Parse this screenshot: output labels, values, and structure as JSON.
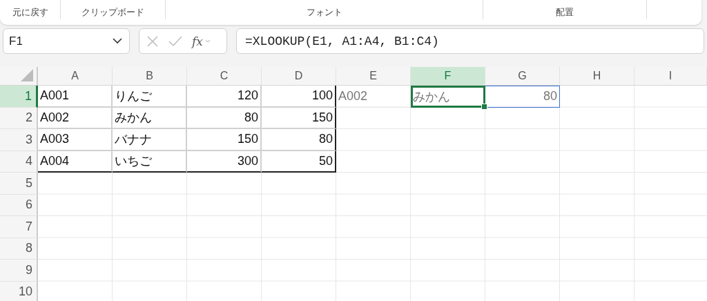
{
  "ribbon": {
    "groups": [
      {
        "label": "元に戻す"
      },
      {
        "label": "クリップボード"
      },
      {
        "label": "フォント"
      },
      {
        "label": "配置"
      }
    ]
  },
  "formula_bar": {
    "name_box": "F1",
    "function_label": "fx",
    "formula": "=XLOOKUP(E1, A1:A4, B1:C4)"
  },
  "sheet": {
    "columns": [
      {
        "label": "A",
        "selected": false
      },
      {
        "label": "B",
        "selected": false
      },
      {
        "label": "C",
        "selected": false
      },
      {
        "label": "D",
        "selected": false
      },
      {
        "label": "E",
        "selected": false
      },
      {
        "label": "F",
        "selected": true
      },
      {
        "label": "G",
        "selected": false
      },
      {
        "label": "H",
        "selected": false
      },
      {
        "label": "I",
        "selected": false
      }
    ],
    "rows": [
      {
        "number": "1",
        "selected": true,
        "cells": [
          {
            "text": "A001",
            "kind": "text",
            "bordered": true,
            "dimmed": false,
            "spill": false,
            "selected": false
          },
          {
            "text": "りんご",
            "kind": "text",
            "bordered": true,
            "dimmed": false,
            "spill": false,
            "selected": false
          },
          {
            "text": "120",
            "kind": "number",
            "bordered": true,
            "dimmed": false,
            "spill": false,
            "selected": false
          },
          {
            "text": "100",
            "kind": "number",
            "bordered": true,
            "dimmed": false,
            "spill": false,
            "selected": false
          },
          {
            "text": "A002",
            "kind": "text",
            "bordered": false,
            "dimmed": true,
            "spill": false,
            "selected": false
          },
          {
            "text": "みかん",
            "kind": "text",
            "bordered": false,
            "dimmed": true,
            "spill": true,
            "selected": true
          },
          {
            "text": "80",
            "kind": "number",
            "bordered": false,
            "dimmed": true,
            "spill": true,
            "selected": false
          }
        ]
      },
      {
        "number": "2",
        "selected": false,
        "cells": [
          {
            "text": "A002",
            "kind": "text",
            "bordered": true,
            "dimmed": false,
            "spill": false,
            "selected": false
          },
          {
            "text": "みかん",
            "kind": "text",
            "bordered": true,
            "dimmed": false,
            "spill": false,
            "selected": false
          },
          {
            "text": "80",
            "kind": "number",
            "bordered": true,
            "dimmed": false,
            "spill": false,
            "selected": false
          },
          {
            "text": "150",
            "kind": "number",
            "bordered": true,
            "dimmed": false,
            "spill": false,
            "selected": false
          }
        ]
      },
      {
        "number": "3",
        "selected": false,
        "cells": [
          {
            "text": "A003",
            "kind": "text",
            "bordered": true,
            "dimmed": false,
            "spill": false,
            "selected": false
          },
          {
            "text": "バナナ",
            "kind": "text",
            "bordered": true,
            "dimmed": false,
            "spill": false,
            "selected": false
          },
          {
            "text": "150",
            "kind": "number",
            "bordered": true,
            "dimmed": false,
            "spill": false,
            "selected": false
          },
          {
            "text": "80",
            "kind": "number",
            "bordered": true,
            "dimmed": false,
            "spill": false,
            "selected": false
          }
        ]
      },
      {
        "number": "4",
        "selected": false,
        "cells": [
          {
            "text": "A004",
            "kind": "text",
            "bordered": true,
            "dimmed": false,
            "spill": false,
            "selected": false
          },
          {
            "text": "いちご",
            "kind": "text",
            "bordered": true,
            "dimmed": false,
            "spill": false,
            "selected": false
          },
          {
            "text": "300",
            "kind": "number",
            "bordered": true,
            "dimmed": false,
            "spill": false,
            "selected": false
          },
          {
            "text": "50",
            "kind": "number",
            "bordered": true,
            "dimmed": false,
            "spill": false,
            "selected": false
          }
        ]
      },
      {
        "number": "5",
        "selected": false
      },
      {
        "number": "6",
        "selected": false
      },
      {
        "number": "7",
        "selected": false
      },
      {
        "number": "8",
        "selected": false
      },
      {
        "number": "9",
        "selected": false
      },
      {
        "number": "10",
        "selected": false
      }
    ]
  }
}
